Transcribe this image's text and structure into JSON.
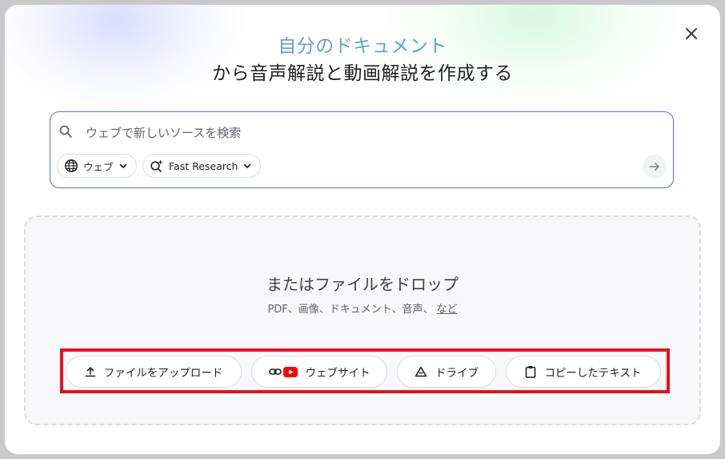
{
  "title": {
    "line1": "自分のドキュメント",
    "line2": "から音声解説と動画解説を作成する"
  },
  "search": {
    "placeholder": "ウェブで新しいソースを検索",
    "source_chip": "ウェブ",
    "mode_chip": "Fast Research"
  },
  "dropzone": {
    "title": "またはファイルをドロップ",
    "subtitle": "PDF、画像、ドキュメント、音声、",
    "more_link": "など"
  },
  "sources": {
    "upload_label": "ファイルをアップロード",
    "website_label": "ウェブサイト",
    "drive_label": "ドライブ",
    "paste_label": "コピーしたテキスト"
  },
  "colors": {
    "accent": "#5b6bdc",
    "highlight": "#e0141e",
    "youtube": "#ff0000"
  },
  "icons": [
    "close-icon",
    "search-icon",
    "globe-icon",
    "chevron-down-icon",
    "research-sparkle-icon",
    "arrow-right-icon",
    "upload-icon",
    "link-icon",
    "youtube-icon",
    "drive-icon",
    "clipboard-icon"
  ]
}
